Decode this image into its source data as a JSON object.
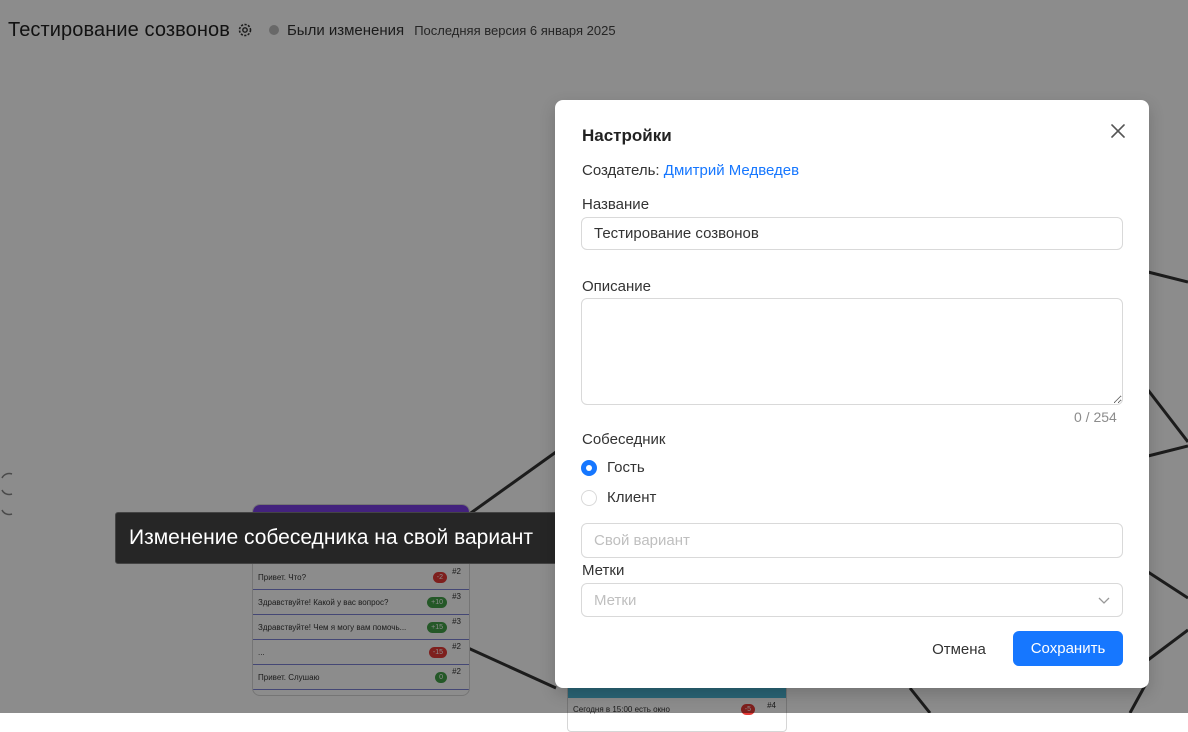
{
  "header": {
    "title": "Тестирование созвонов",
    "status": "Были изменения",
    "version": "Последняя версия 6 января 2025"
  },
  "canvas_node": {
    "rows": [
      {
        "text": "Привет. Что?",
        "score": "-2",
        "tone": "red",
        "num": "#2"
      },
      {
        "text": "Здравствуйте! Какой у вас вопрос?",
        "score": "+10",
        "tone": "green",
        "num": "#3"
      },
      {
        "text": "Здравствуйте! Чем я могу вам помочь...",
        "score": "+15",
        "tone": "green",
        "num": "#3"
      },
      {
        "text": "...",
        "score": "-15",
        "tone": "red",
        "num": "#2"
      },
      {
        "text": "Привет. Слушаю",
        "score": "0",
        "tone": "green",
        "num": "#2"
      }
    ]
  },
  "canvas_node2": {
    "row": {
      "text": "Сегодня в 15:00 есть окно",
      "score": "-5",
      "tone": "red",
      "num": "#4"
    }
  },
  "tooltip": {
    "text": "Изменение собеседника на свой вариант"
  },
  "modal": {
    "title": "Настройки",
    "creator_label": "Создатель:",
    "creator_name": "Дмитрий Медведев",
    "name_label": "Название",
    "name_value": "Тестирование созвонов",
    "description_label": "Описание",
    "description_value": "",
    "counter": "0 / 254",
    "interlocutor_label": "Собеседник",
    "radio_options": [
      {
        "label": "Гость",
        "checked": true
      },
      {
        "label": "Клиент",
        "checked": false
      }
    ],
    "custom_placeholder": "Свой вариант",
    "tags_label": "Метки",
    "tags_placeholder": "Метки",
    "cancel_label": "Отмена",
    "save_label": "Сохранить"
  },
  "colors": {
    "accent": "#1677ff",
    "node_header": "#7b3fe4",
    "node2_header": "#4db6d6",
    "overlay": "rgba(0,0,0,0.45)"
  },
  "icons": {
    "settings": "gear-icon",
    "close": "close-icon",
    "select": "chevron-down-icon"
  }
}
